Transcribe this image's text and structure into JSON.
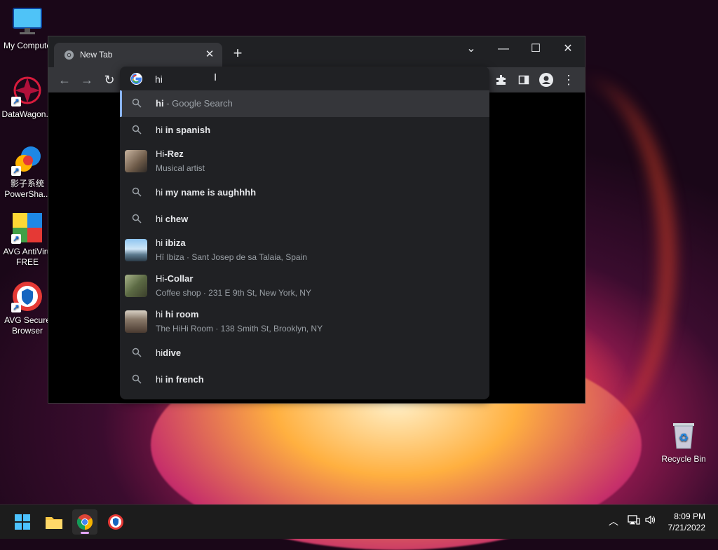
{
  "desktop": {
    "icons": [
      {
        "label": "My Compute"
      },
      {
        "label": "DataWagon..."
      },
      {
        "label": "影子系统 PowerSha..."
      },
      {
        "label": "AVG AntiViru FREE"
      },
      {
        "label": "AVG Secure Browser"
      },
      {
        "label": "Recycle Bin"
      }
    ]
  },
  "browser": {
    "tab_title": "New Tab",
    "omnibox_value": "hi",
    "suggestions": [
      {
        "prefix": "hi",
        "rest": "- Google Search",
        "type": "search",
        "selected": true
      },
      {
        "prefix": "hi",
        "rest": "in spanish",
        "type": "search"
      },
      {
        "prefix": "Hi",
        "rest": "-Rez",
        "sub": "Musical artist",
        "type": "entity"
      },
      {
        "prefix": "hi",
        "rest": "my name is aughhhh",
        "type": "search"
      },
      {
        "prefix": "hi",
        "rest": "chew",
        "type": "search"
      },
      {
        "prefix": "hi",
        "rest": "ibiza",
        "sub": "Hï Ibiza · Sant Josep de sa Talaia, Spain",
        "type": "entity"
      },
      {
        "prefix": "Hi",
        "rest": "-Collar",
        "sub": "Coffee shop · 231 E 9th St, New York, NY",
        "type": "entity"
      },
      {
        "prefix": "hi",
        "rest": "hi room",
        "sub": "The HiHi Room · 138 Smith St, Brooklyn, NY",
        "type": "entity"
      },
      {
        "prefix": "hi",
        "rest": "dive",
        "type": "search"
      },
      {
        "prefix": "hi",
        "rest": "in french",
        "type": "search"
      }
    ]
  },
  "taskbar": {
    "time": "8:09 PM",
    "date": "7/21/2022"
  },
  "icons": {
    "start": "windows-start-icon",
    "explorer": "folder-icon",
    "chrome": "chrome-icon",
    "avg_browser": "avg-browser-icon",
    "search": "magnifier-icon"
  },
  "colors": {
    "omnibox_bg": "#202124",
    "selected_row": "#35363a",
    "accent": "#8ab4f8"
  }
}
